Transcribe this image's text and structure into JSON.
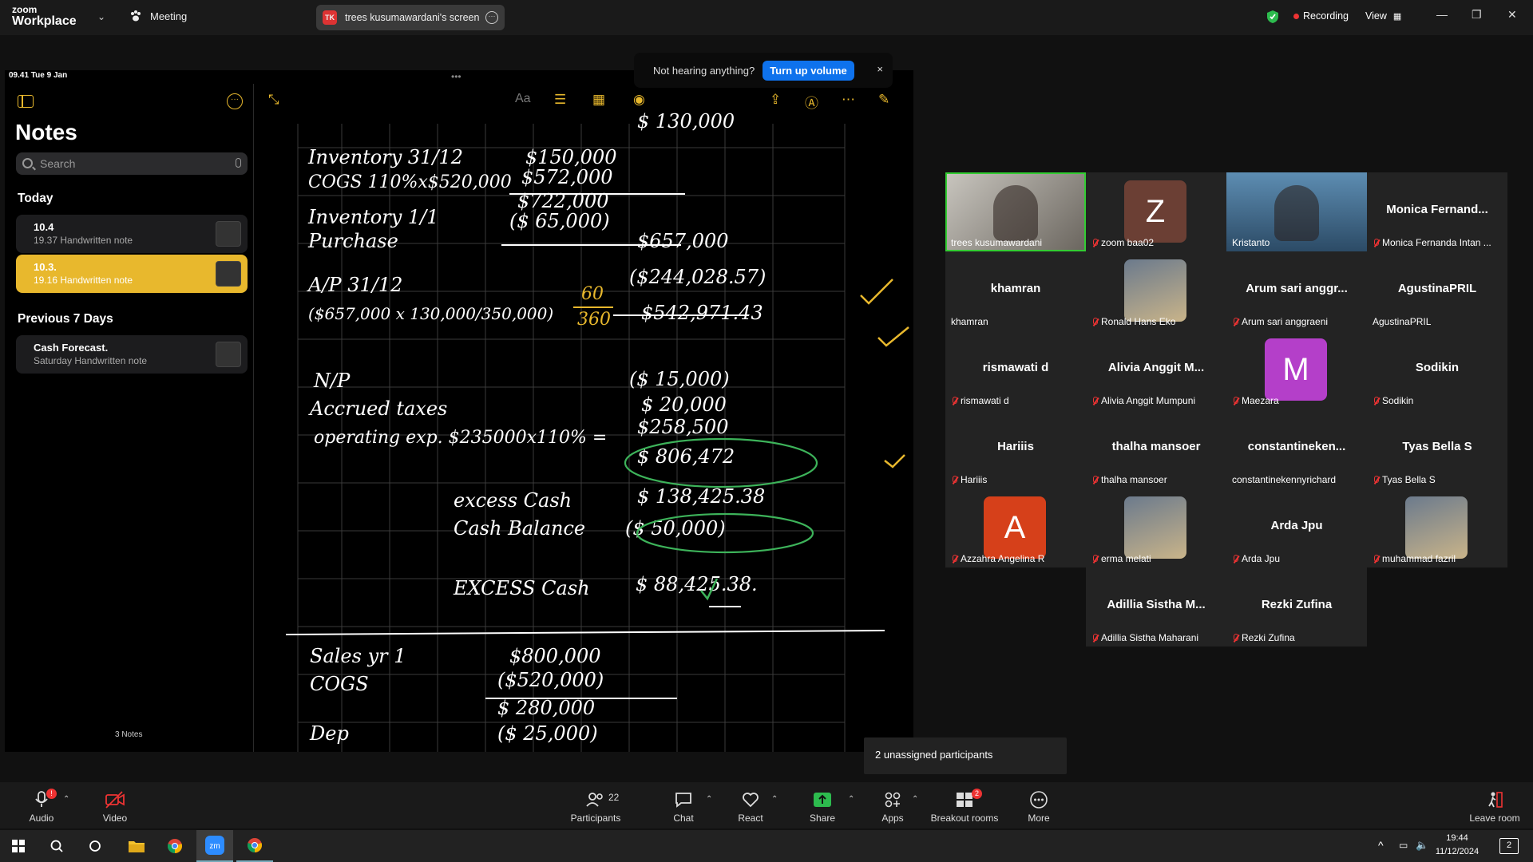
{
  "app": {
    "brand_line1": "zoom",
    "brand_line2": "Workplace",
    "meeting_label": "Meeting"
  },
  "screen_tab": {
    "initials": "TK",
    "title": "trees kusumawardani's screen"
  },
  "top_right": {
    "recording": "Recording",
    "view": "View"
  },
  "banner": {
    "text": "Not hearing anything?",
    "button": "Turn up volume",
    "close": "×"
  },
  "ipad": {
    "status_time": "09.41  Tue 9 Jan"
  },
  "notes": {
    "title": "Notes",
    "search_placeholder": "Search",
    "today_header": "Today",
    "prev_header": "Previous 7 Days",
    "items": [
      {
        "title": "10.4",
        "subtitle": "19.37  Handwritten note"
      },
      {
        "title": "10.3.",
        "subtitle": "19.16  Handwritten note"
      },
      {
        "title": "Cash Forecast.",
        "subtitle": "Saturday  Handwritten note"
      }
    ],
    "count": "3 Notes"
  },
  "handwriting": [
    "Inventory 31/12",
    "COGS 110%x$520,000",
    "Inventory 1/1",
    "Purchase",
    "A/P 31/12",
    "($657,000 x 130,000/350,000)",
    "60",
    "360",
    "$150,000",
    "$572,000",
    "$722,000",
    "($ 65,000)",
    "$657,000",
    "($244,028.57)",
    "$542,971.43",
    "N/P",
    "Accrued taxes",
    "operating exp. $235000x110% =",
    "($ 15,000)",
    "$ 20,000",
    "$258,500",
    "$ 806,472",
    "excess Cash",
    "Cash Balance",
    "$ 138,425.38",
    "($ 50,000)",
    "EXCESS Cash",
    "$ 88,425.38.",
    "Sales yr 1",
    "COGS",
    "$800,000",
    "($520,000)",
    "$ 280,000",
    "Dep",
    "($ 25,000)",
    "$ 130,000"
  ],
  "participants": [
    {
      "name": "trees kusumawardani",
      "label": "trees kusumawardani",
      "muted": false,
      "type": "video",
      "active": true
    },
    {
      "name": "zoom baa02",
      "label": "zoom baa02",
      "muted": true,
      "type": "avatar",
      "initial": "Z",
      "color": "#6b3f34"
    },
    {
      "name": "Kristanto",
      "label": "Kristanto",
      "muted": false,
      "type": "video"
    },
    {
      "name": "Monica  Fernand...",
      "label": "Monica Fernanda Intan ...",
      "muted": true,
      "type": "name"
    },
    {
      "name": "khamran",
      "label": "khamran",
      "muted": false,
      "type": "name"
    },
    {
      "name": "Ronald Hans Eko",
      "label": "Ronald Hans Eko",
      "muted": true,
      "type": "photo"
    },
    {
      "name": "Arum sari anggr...",
      "label": "Arum sari anggraeni",
      "muted": true,
      "type": "name"
    },
    {
      "name": "AgustinaPRIL",
      "label": "AgustinaPRIL",
      "muted": false,
      "type": "name"
    },
    {
      "name": "rismawati d",
      "label": "rismawati d",
      "muted": true,
      "type": "name"
    },
    {
      "name": "Alivia  Anggit  M...",
      "label": "Alivia Anggit Mumpuni",
      "muted": true,
      "type": "name"
    },
    {
      "name": "Maezara",
      "label": "Maezara",
      "muted": true,
      "type": "avatar",
      "initial": "M",
      "color": "#b43fc9"
    },
    {
      "name": "Sodikin",
      "label": "Sodikin",
      "muted": true,
      "type": "name"
    },
    {
      "name": "Hariiis",
      "label": "Hariiis",
      "muted": true,
      "type": "name"
    },
    {
      "name": "thalha mansoer",
      "label": "thalha mansoer",
      "muted": true,
      "type": "name"
    },
    {
      "name": "constantineken...",
      "label": "constantinekennyrichard",
      "muted": false,
      "type": "name"
    },
    {
      "name": "Tyas Bella S",
      "label": "Tyas Bella S",
      "muted": true,
      "type": "name"
    },
    {
      "name": "Azzahra Angelina R",
      "label": "Azzahra Angelina R",
      "muted": true,
      "type": "avatar",
      "initial": "A",
      "color": "#d6401a"
    },
    {
      "name": "erma melati",
      "label": "erma melati",
      "muted": true,
      "type": "photo"
    },
    {
      "name": "Arda Jpu",
      "label": "Arda Jpu",
      "muted": true,
      "type": "name"
    },
    {
      "name": "muhammad fazril",
      "label": "muhammad fazril",
      "muted": true,
      "type": "photo"
    },
    {
      "name": "Adillia  Sistha  M...",
      "label": "Adillia Sistha Maharani",
      "muted": true,
      "type": "name"
    },
    {
      "name": "Rezki Zufina",
      "label": "Rezki Zufina",
      "muted": true,
      "type": "name"
    }
  ],
  "unassigned": "2 unassigned participants",
  "toolbar": {
    "audio": "Audio",
    "video": "Video",
    "participants": "Participants",
    "participants_count": "22",
    "chat": "Chat",
    "react": "React",
    "share": "Share",
    "apps": "Apps",
    "breakout": "Breakout rooms",
    "breakout_badge": "2",
    "more": "More",
    "leave": "Leave room"
  },
  "taskbar": {
    "time": "19:44",
    "date": "11/12/2024",
    "notif": "2"
  }
}
